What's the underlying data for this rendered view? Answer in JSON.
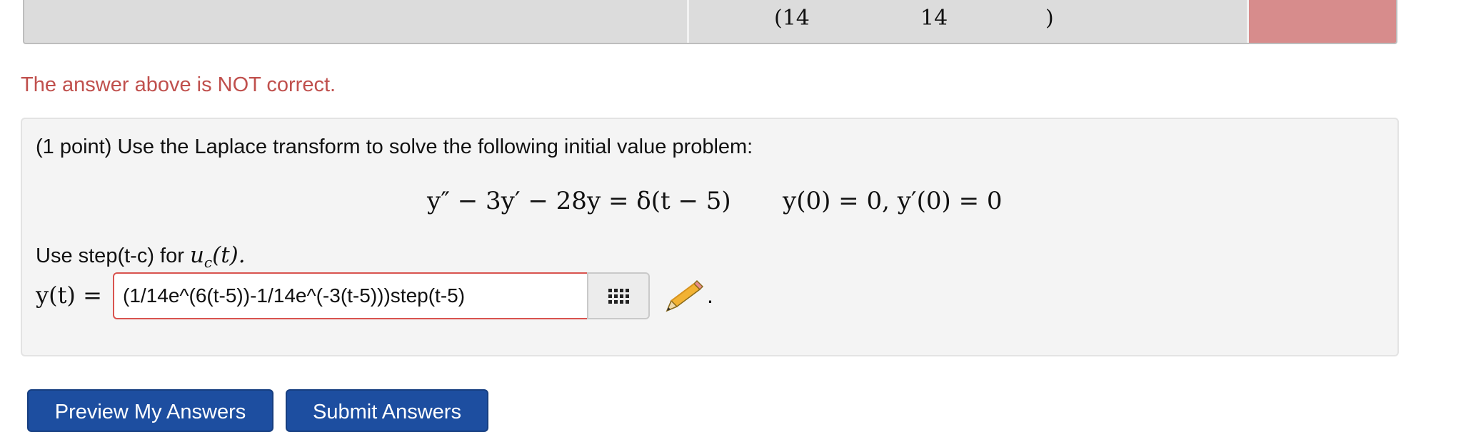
{
  "results_table": {
    "fragment_a": "(14",
    "fragment_b": "14",
    "fragment_c": ")"
  },
  "feedback": {
    "error_text": "The answer above is NOT correct."
  },
  "problem": {
    "statement": "(1 point) Use the Laplace transform to solve the following initial value problem:",
    "equation": "y″ − 3y′ − 28y = δ(t − 5)",
    "initial_conditions": "y(0) = 0,  y′(0) = 0",
    "hint_prefix": "Use step(t-c) for ",
    "hint_math_base": "u",
    "hint_math_sub": "c",
    "hint_math_arg": "(t).",
    "answer_label": "y(t) =",
    "answer_value": "(1/14e^(6(t-5))-1/14e^(-3(t-5)))step(t-5)",
    "trailing": "."
  },
  "buttons": {
    "preview": "Preview My Answers",
    "submit": "Submit Answers"
  },
  "icons": {
    "palette": "grid-icon",
    "pencil": "pencil-icon"
  },
  "colors": {
    "error": "#c0504d",
    "incorrect_cell": "#d78c8c",
    "button_primary": "#1d4ea0",
    "input_error_border": "#d9534f"
  }
}
